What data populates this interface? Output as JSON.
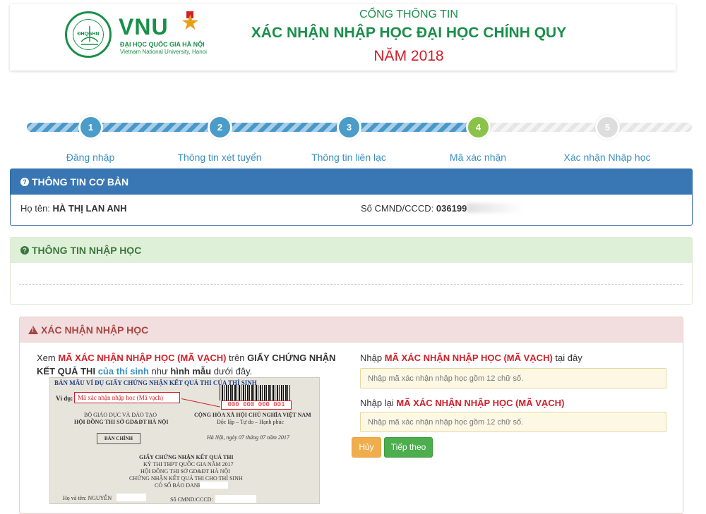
{
  "header": {
    "logo_abbr": "ĐHQGHN",
    "brand": "VNU",
    "brand_sub_vi": "ĐẠI HỌC QUỐC GIA HÀ NỘI",
    "brand_sub_en": "Vietnam National University, Hanoi",
    "title_line1": "CỔNG THÔNG TIN",
    "title_line2": "XÁC NHẬN NHẬP HỌC ĐẠI HỌC CHÍNH QUY",
    "title_line3": "NĂM 2018",
    "colors": {
      "brand_green": "#1a8f4a",
      "accent_red": "#d0202a"
    }
  },
  "progress": {
    "current_step": 4,
    "total_steps": 5,
    "steps": [
      {
        "number": "1",
        "label": "Đăng nhập",
        "state": "done"
      },
      {
        "number": "2",
        "label": "Thông tin xét tuyển",
        "state": "done"
      },
      {
        "number": "3",
        "label": "Thông tin liên lạc",
        "state": "done"
      },
      {
        "number": "4",
        "label": "Mã xác nhận",
        "state": "active"
      },
      {
        "number": "5",
        "label": "Xác nhận Nhập học",
        "state": "todo"
      }
    ],
    "colors": {
      "done": "#4a9cc9",
      "active": "#8bc34a",
      "todo": "#dddddd"
    }
  },
  "basic_info": {
    "icon": "question-circle-icon",
    "title": "THÔNG TIN CƠ BẢN",
    "name_label": "Họ tên:",
    "name_value": "HÀ THỊ LAN ANH",
    "id_label": "Số CMND/CCCD:",
    "id_value": "036199"
  },
  "admission_info": {
    "icon": "question-circle-icon",
    "title": "THÔNG TIN NHẬP HỌC"
  },
  "confirm": {
    "icon": "warning-icon",
    "title": "XÁC NHẬN NHẬP HỌC",
    "instr_p1": "Xem ",
    "instr_code": "MÃ XÁC NHẬN NHẬP HỌC (MÃ VẠCH)",
    "instr_p2": " trên ",
    "instr_cert": "GIẤY CHỨNG NHẬN KẾT QUẢ THI",
    "instr_p3": " ",
    "instr_of": "của thí sinh",
    "instr_p4": " như ",
    "instr_sample": "hình mẫu",
    "instr_p5": " dưới đây.",
    "certificate": {
      "header": "BẢN MẪU VÍ DỤ GIẤY CHỨNG NHẬN KẾT QUẢ THI CỦA THÍ SINH",
      "example_label": "Ví dụ:",
      "example_box": "Mã xác nhận nhập học (Mã vạch)",
      "barcode_number": "000 000 000 001",
      "ministry": "BỘ GIÁO DỤC VÀ ĐÀO TẠO",
      "council": "HỘI ĐỒNG THI SỞ GD&ĐT HÀ NỘI",
      "republic": "CỘNG HÒA XÃ HỘI CHỦ NGHĨA VIỆT NAM",
      "motto": "Độc lập – Tự do – Hạnh phúc",
      "copy_label": "BẢN CHÍNH",
      "date": "Hà Nội, ngày 07 tháng 07 năm 2017",
      "cert_title": "GIẤY CHỨNG NHẬN KẾT QUẢ THI",
      "exam": "KỲ THI THPT QUỐC GIA NĂM 2017",
      "council2": "HỘI ĐỒNG THI SỞ GD&ĐT HÀ NỘI",
      "certifies": "CHỨNG NHẬN KẾT QUẢ THI CHO THÍ SINH",
      "sbd": "CÓ SỐ BÁO DANH:",
      "name_line": "Họ và tên: NGUYỄN",
      "id_line": "Số CMND/CCCD:"
    },
    "input1_label_p1": "Nhập ",
    "input1_label_code": "MÃ XÁC NHẬN NHẬP HỌC (MÃ VẠCH)",
    "input1_label_p2": " tại đây",
    "input1_placeholder": "Nhập mã xác nhận nhập học gồm 12 chữ số.",
    "input2_label_p1": "Nhập lại ",
    "input2_label_code": "MÃ XÁC NHẬN NHẬP HỌC (MÃ VẠCH)",
    "input2_placeholder": "Nhập mã xác nhận nhập học gồm 12 chữ số.",
    "cancel_label": "Hủy",
    "next_label": "Tiếp theo"
  }
}
